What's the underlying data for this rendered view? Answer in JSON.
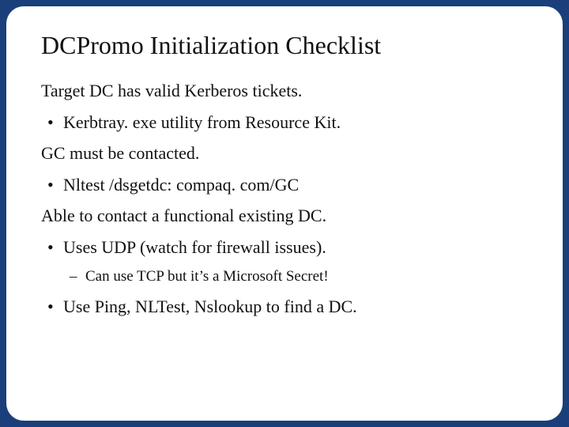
{
  "title": "DCPromo Initialization Checklist",
  "lines": {
    "l0": "Target DC has valid Kerberos tickets.",
    "l1": "Kerbtray. exe utility from Resource Kit.",
    "l2": "GC must be contacted.",
    "l3": "Nltest /dsgetdc: compaq. com/GC",
    "l4": "Able to contact a functional existing DC.",
    "l5": "Uses UDP (watch for firewall issues).",
    "l6": "Can use TCP but it’s a Microsoft Secret!",
    "l7": "Use Ping, NLTest, Nslookup to find a DC."
  }
}
